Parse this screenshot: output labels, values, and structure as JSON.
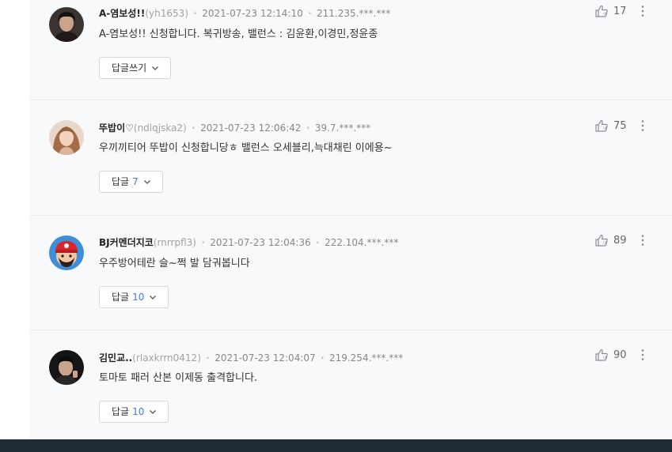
{
  "comments": [
    {
      "nickname": "A-염보성!!",
      "user_id": "(yh1653)",
      "time": "2021-07-23 12:14:10",
      "ip": "211.235.***.***",
      "text": "A-염보성!! 신청합니다. 복귀방송, 밸런스 : 김윤환,이경민,정윤종",
      "reply_label": "답글쓰기",
      "reply_count": "",
      "likes": "17",
      "avatar": "avatar-dark-hair-person"
    },
    {
      "nickname": "뚜밥이♡",
      "user_id": "(ndlqjska2)",
      "time": "2021-07-23 12:06:42",
      "ip": "39.7.***.***",
      "text": "우끼끼티어 뚜밥이 신청합니당ㅎ 밸런스 오세블리,늑대채린 이에용~",
      "reply_label": "답글",
      "reply_count": "7",
      "likes": "75",
      "avatar": "avatar-long-brown-hair-woman"
    },
    {
      "nickname": "BJ커멘더지코",
      "user_id": "(rnrrpfl3)",
      "time": "2021-07-23 12:04:36",
      "ip": "222.104.***.***",
      "text": "우주방어테란 슬~쩍 발 담궈봅니다",
      "reply_label": "답글",
      "reply_count": "10",
      "likes": "89",
      "avatar": "avatar-cartoon-red-cap"
    },
    {
      "nickname": "김민교..",
      "user_id": "(rlaxkrrn0412)",
      "time": "2021-07-23 12:04:07",
      "ip": "219.254.***.***",
      "text": "토마토 패러 산본 이제동 출격합니다.",
      "reply_label": "답글",
      "reply_count": "10",
      "likes": "90",
      "avatar": "avatar-man-dark-photo"
    }
  ],
  "icons": {
    "like": "thumbs-up-icon",
    "more": "more-vertical-icon",
    "chevron": "chevron-down-icon"
  },
  "colors": {
    "list_background": "#f8f9fb",
    "reply_count": "#3f7fd6",
    "footer": "#1e2b34"
  }
}
